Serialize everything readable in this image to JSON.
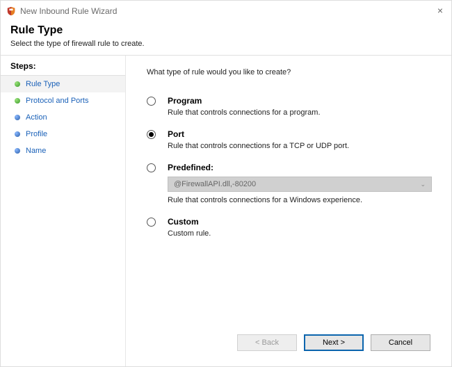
{
  "window": {
    "title": "New Inbound Rule Wizard",
    "close": "×"
  },
  "header": {
    "title": "Rule Type",
    "subtitle": "Select the type of firewall rule to create."
  },
  "sidebar": {
    "title": "Steps:",
    "items": [
      {
        "label": "Rule Type"
      },
      {
        "label": "Protocol and Ports"
      },
      {
        "label": "Action"
      },
      {
        "label": "Profile"
      },
      {
        "label": "Name"
      }
    ]
  },
  "content": {
    "prompt": "What type of rule would you like to create?",
    "options": {
      "program": {
        "title": "Program",
        "desc": "Rule that controls connections for a program.",
        "selected": false
      },
      "port": {
        "title": "Port",
        "desc": "Rule that controls connections for a TCP or UDP port.",
        "selected": true
      },
      "predefined": {
        "title": "Predefined:",
        "desc": "Rule that controls connections for a Windows experience.",
        "selected": false,
        "combo_value": "@FirewallAPI.dll,-80200"
      },
      "custom": {
        "title": "Custom",
        "desc": "Custom rule.",
        "selected": false
      }
    }
  },
  "footer": {
    "back": "< Back",
    "next": "Next >",
    "cancel": "Cancel"
  }
}
